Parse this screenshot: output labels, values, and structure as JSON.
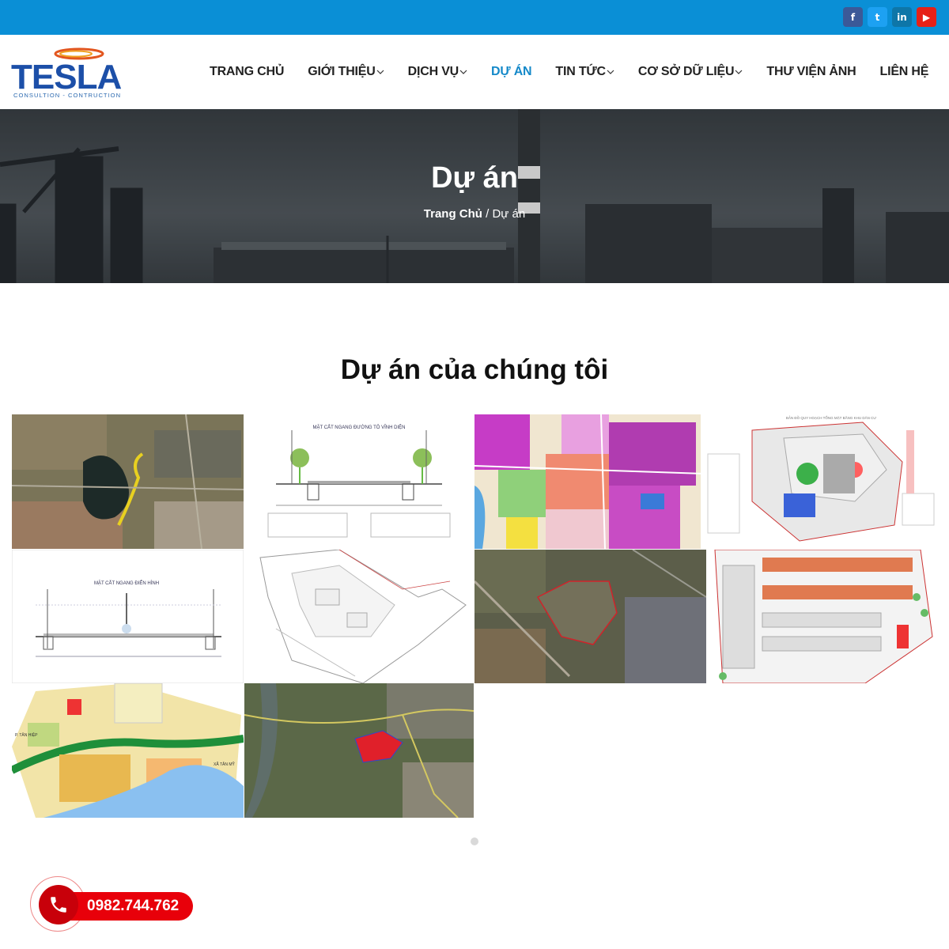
{
  "header": {
    "logo": {
      "name": "TESLA",
      "tagline": "CONSULTION - CONTRUCTION"
    },
    "nav": [
      {
        "label": "TRANG CHỦ",
        "dropdown": false,
        "active": false
      },
      {
        "label": "GIỚI THIỆU",
        "dropdown": true,
        "active": false
      },
      {
        "label": "DỊCH VỤ",
        "dropdown": true,
        "active": false
      },
      {
        "label": "DỰ ÁN",
        "dropdown": false,
        "active": true
      },
      {
        "label": "TIN TỨC",
        "dropdown": true,
        "active": false
      },
      {
        "label": "CƠ SỞ DỮ LIỆU",
        "dropdown": true,
        "active": false
      },
      {
        "label": "THƯ VIỆN ẢNH",
        "dropdown": false,
        "active": false
      },
      {
        "label": "LIÊN HỆ",
        "dropdown": false,
        "active": false
      }
    ],
    "socials": [
      {
        "icon": "facebook-icon",
        "glyph": "f",
        "color": "#3b5998"
      },
      {
        "icon": "twitter-icon",
        "glyph": "t",
        "color": "#1da1f2"
      },
      {
        "icon": "linkedin-icon",
        "glyph": "in",
        "color": "#0e76a8"
      },
      {
        "icon": "youtube-icon",
        "glyph": "▶",
        "color": "#e62117"
      }
    ]
  },
  "hero": {
    "title": "Dự án",
    "breadcrumb": {
      "home": "Trang Chủ",
      "separator": "/",
      "current": "Dự án"
    }
  },
  "projects": {
    "title": "Dự án của chúng tôi",
    "plan_title": "BẢN ĐỒ QUY HOẠCH TỔNG MẶT BẰNG KHU DÂN CƯ",
    "section_title": "MẶT CẮT NGANG ĐƯỜNG TÔ VĨNH DIỆN",
    "section_title_2": "MẶT CẮT NGANG ĐIỂN HÌNH",
    "label_1": "P. TÂN HIỆP",
    "label_2": "XÃ TÂN MỸ"
  },
  "contact": {
    "phone": "0982.744.762",
    "icon": "phone-icon"
  }
}
